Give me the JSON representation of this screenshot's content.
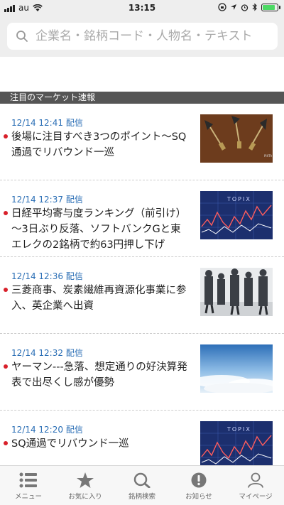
{
  "status": {
    "carrier": "au",
    "time": "13:15"
  },
  "search": {
    "placeholder": "企業名・銘柄コード・人物名・テキスト"
  },
  "section": {
    "title": "注目のマーケット速報"
  },
  "news": [
    {
      "time": "12/14 12:41",
      "tag": "配信",
      "title": "後場に注目すべき3つのポイント～SQ通過でリバウンド一巡",
      "thumb": "darts-image"
    },
    {
      "time": "12/14 12:37",
      "tag": "配信",
      "title": "日経平均寄与度ランキング（前引け）～3日ぶり反落、ソフトバンクGと東エレクの2銘柄で約63円押し下げ",
      "thumb": "topix-chart-image"
    },
    {
      "time": "12/14 12:36",
      "tag": "配信",
      "title": "三菱商事、炭素繊維再資源化事業に参入、英企業へ出資",
      "thumb": "business-people-image"
    },
    {
      "time": "12/14 12:32",
      "tag": "配信",
      "title": "ヤーマン---急落、想定通りの好決算発表で出尽くし感が優勢",
      "thumb": "sky-clouds-image"
    },
    {
      "time": "12/14 12:20",
      "tag": "配信",
      "title": "SQ通過でリバウンド一巡",
      "thumb": "topix-chart-image"
    }
  ],
  "tabs": [
    {
      "label": "メニュー",
      "icon": "menu-icon"
    },
    {
      "label": "お気に入り",
      "icon": "star-icon"
    },
    {
      "label": "銘柄検索",
      "icon": "search-icon"
    },
    {
      "label": "お知らせ",
      "icon": "notice-icon"
    },
    {
      "label": "マイページ",
      "icon": "person-icon"
    }
  ],
  "colors": {
    "accent_blue": "#2a6eb5",
    "bullet_red": "#d8202a",
    "section_bg": "#555555"
  }
}
